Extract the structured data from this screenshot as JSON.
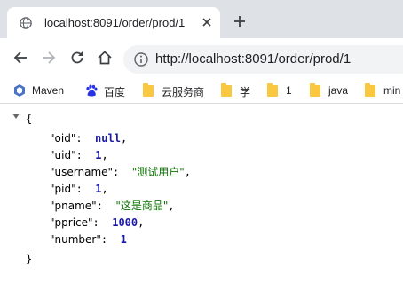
{
  "browser": {
    "tab_title": "localhost:8091/order/prod/1",
    "url_host": "localhost",
    "url_rest": ":8091/order/prod/1",
    "url_scheme": "http://"
  },
  "bookmarks": [
    {
      "label": "Maven",
      "icon": "maven-hex-icon"
    },
    {
      "label": "百度",
      "icon": "baidu-paw-icon"
    },
    {
      "label": "云服务商",
      "icon": "folder-icon"
    },
    {
      "label": "学",
      "icon": "folder-icon"
    },
    {
      "label": "1",
      "icon": "folder-icon"
    },
    {
      "label": "java",
      "icon": "folder-icon"
    },
    {
      "label": "min",
      "icon": "folder-icon"
    }
  ],
  "json": {
    "open_brace": "{",
    "close_brace": "}",
    "fields": [
      {
        "key": "\"oid\"",
        "value": "null",
        "type": "null"
      },
      {
        "key": "\"uid\"",
        "value": "1",
        "type": "number"
      },
      {
        "key": "\"username\"",
        "value": "\"测试用户\"",
        "type": "string"
      },
      {
        "key": "\"pid\"",
        "value": "1",
        "type": "number"
      },
      {
        "key": "\"pname\"",
        "value": "\"这是商品\"",
        "type": "string"
      },
      {
        "key": "\"pprice\"",
        "value": "1000",
        "type": "number"
      },
      {
        "key": "\"number\"",
        "value": "1",
        "type": "number"
      }
    ]
  },
  "colors": {
    "tabstrip": "#dee1e6",
    "number": "#1a1aa6",
    "string": "#0b7500",
    "folder": "#f9c740"
  }
}
